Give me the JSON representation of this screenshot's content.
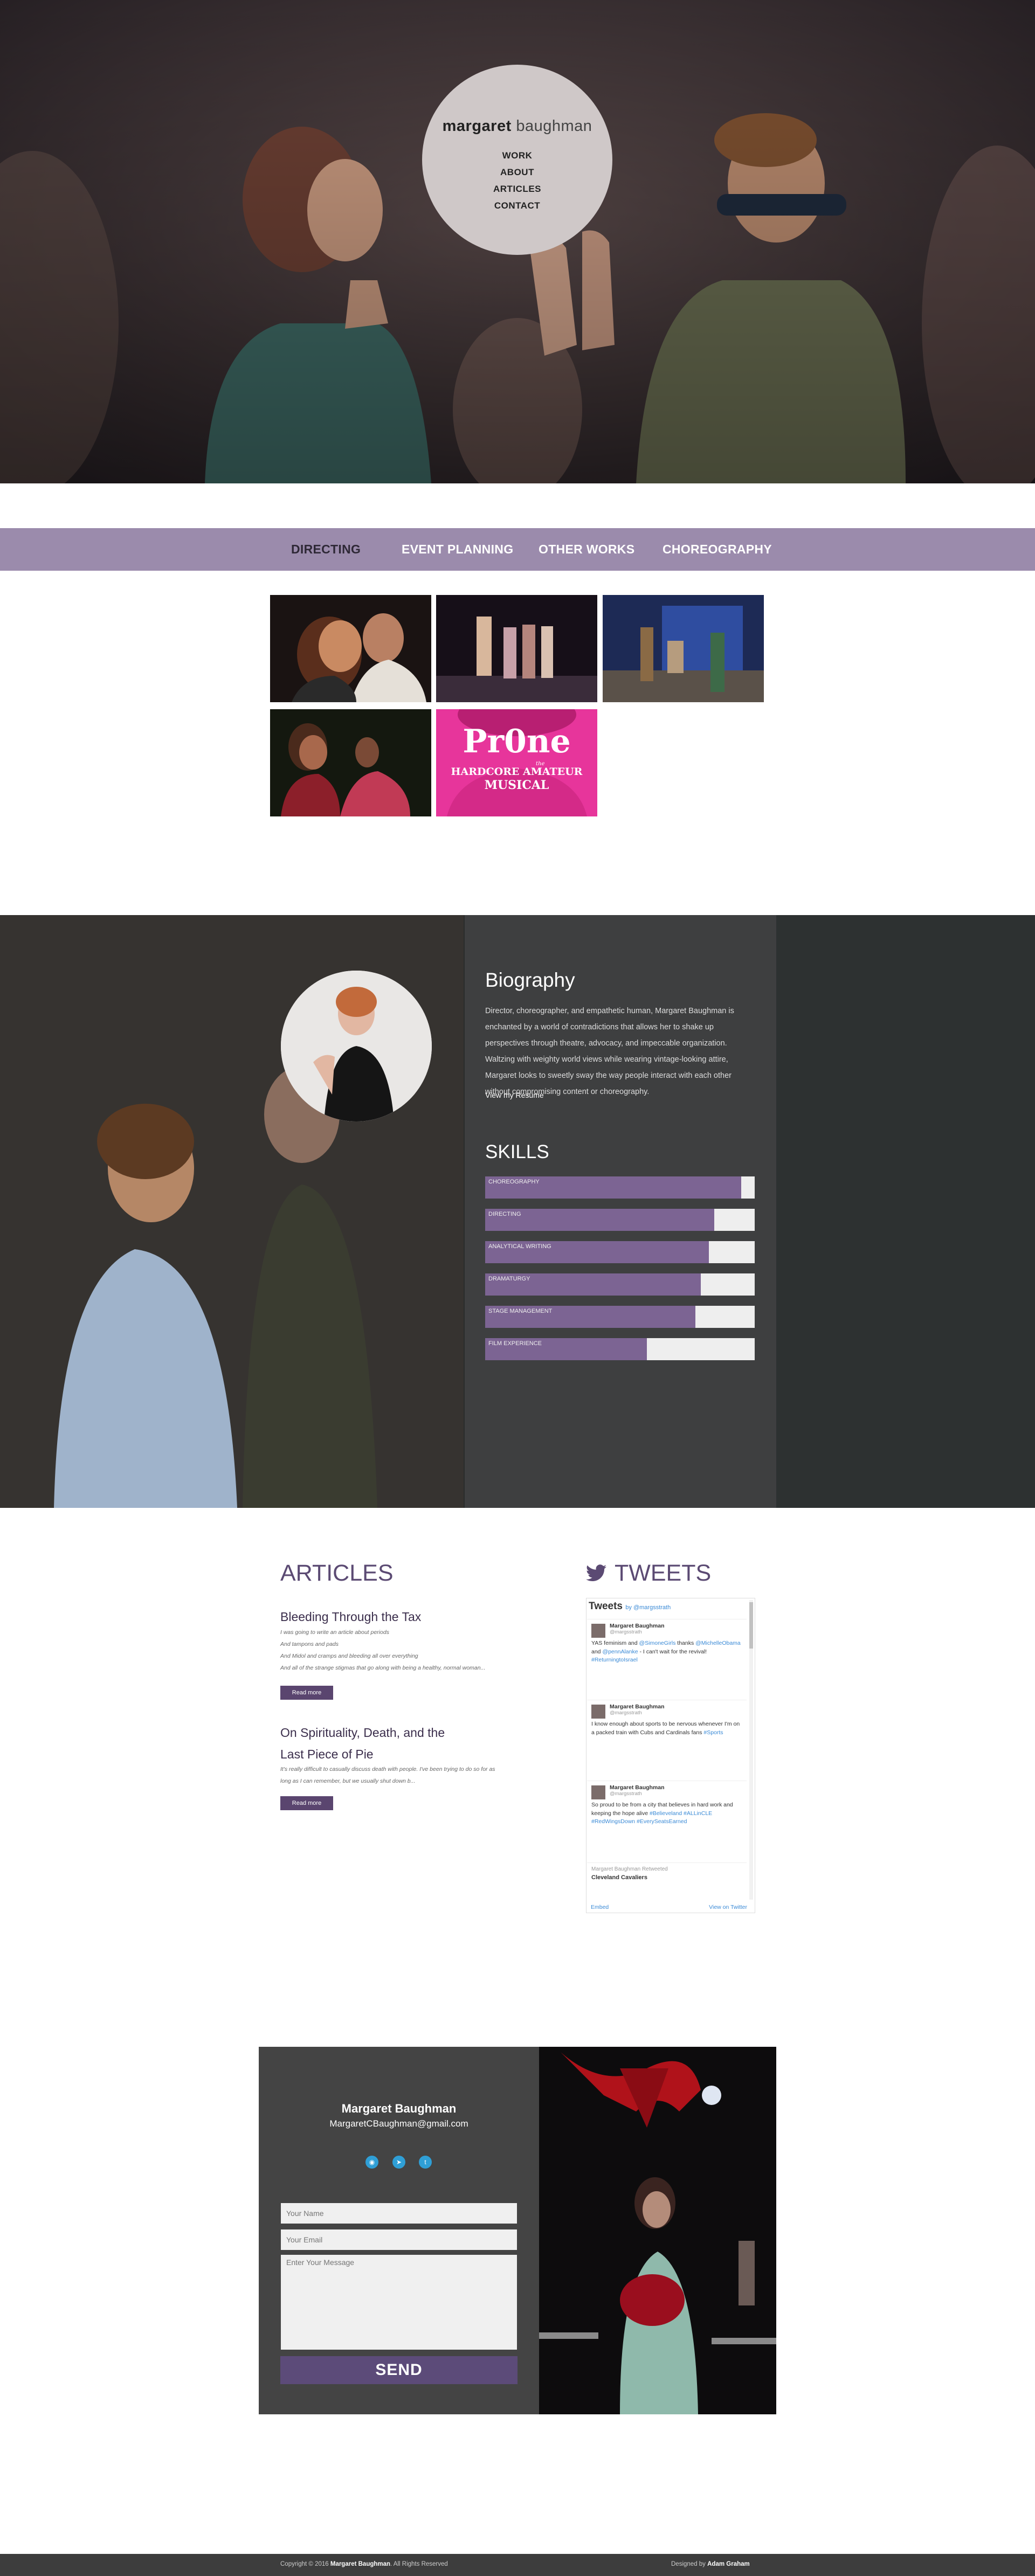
{
  "hero": {
    "name_first": "margaret",
    "name_last": "baughman",
    "nav": [
      "WORK",
      "ABOUT",
      "ARTICLES",
      "CONTACT"
    ]
  },
  "categories": [
    "DIRECTING",
    "EVENT PLANNING",
    "OTHER WORKS",
    "CHOREOGRAPHY"
  ],
  "portfolio": {
    "tile5_text_line1": "Pr0ne",
    "tile5_text_line2": "HARDCORE AMATEUR",
    "tile5_text_line3": "MUSICAL",
    "tile5_text_small": "the"
  },
  "biography": {
    "title": "Biography",
    "text": "Director, choreographer, and empathetic human, Margaret Baughman is enchanted by a world of contradictions that allows her to shake up perspectives through theatre, advocacy, and impeccable organization. Waltzing with weighty world views while wearing vintage-looking attire, Margaret looks to sweetly sway the way people interact with each other without compromising content or choreography.",
    "resume_link": "View my Resume",
    "skills_title": "SKILLS",
    "skills": [
      {
        "label": "CHOREOGRAPHY",
        "level": 0.95
      },
      {
        "label": "DIRECTING",
        "level": 0.85
      },
      {
        "label": "ANALYTICAL WRITING",
        "level": 0.83
      },
      {
        "label": "DRAMATURGY",
        "level": 0.8
      },
      {
        "label": "STAGE MANAGEMENT",
        "level": 0.78
      },
      {
        "label": "FILM EXPERIENCE",
        "level": 0.6
      }
    ]
  },
  "articles": {
    "title": "ARTICLES",
    "items": [
      {
        "title": "Bleeding Through the Tax",
        "excerpt": [
          "I was going to write an article about periods",
          "And tampons and pads",
          "And Midol and cramps and bleeding all over everything",
          "And all of the strange stigmas that go along with being a healthy, normal woman..."
        ],
        "button": "Read more"
      },
      {
        "title_line1": "On Spirituality, Death, and the",
        "title_line2": "Last Piece of Pie",
        "excerpt": [
          "It's really difficult to casually discuss death with people. I've been trying to do so for as",
          "long as I can remember, but we usually shut down b..."
        ],
        "button": "Read more"
      }
    ]
  },
  "tweets": {
    "title": "TWEETS",
    "widget_title": "Tweets",
    "widget_by": "by @margsstrath",
    "items": [
      {
        "name": "Margaret Baughman",
        "handle": "@margsstrath",
        "text_parts": [
          "YAS feminism and ",
          "@SimoneGirls",
          " thanks ",
          "@MichelleObama",
          " and ",
          "@pennAlanke",
          " - I can't wait for the revival! ",
          "#ReturningtoIsrael"
        ]
      },
      {
        "name": "Margaret Baughman",
        "handle": "@margsstrath",
        "text_parts": [
          "I know enough about sports to be nervous whenever I'm on a packed train with Cubs and Cardinals fans ",
          "#Sports"
        ]
      },
      {
        "name": "Margaret Baughman",
        "handle": "@margsstrath",
        "text_parts": [
          "So proud to be from a city that believes in hard work and keeping the hope alive ",
          "#Believeland #ALLinCLE #RedWingsDown #EverySeatsEarned"
        ]
      },
      {
        "retweet": "Margaret Baughman Retweeted",
        "name": "Cleveland Cavaliers"
      }
    ],
    "embed": "Embed",
    "view_on": "View on Twitter"
  },
  "contact": {
    "name": "Margaret Baughman",
    "email": "MargaretCBaughman@gmail.com",
    "social": [
      "instagram-icon",
      "twitter-icon",
      "tumblr-icon"
    ],
    "placeholder_name": "Your Name",
    "placeholder_email": "Your Email",
    "placeholder_message": "Enter Your Message",
    "send": "SEND"
  },
  "footer": {
    "copy_prefix": "Copyright © 2016 ",
    "copy_name": "Margaret Baughman",
    "copy_suffix": ". All Rights Reserved",
    "designed_prefix": "Designed by ",
    "designed_name": "Adam Graham"
  }
}
